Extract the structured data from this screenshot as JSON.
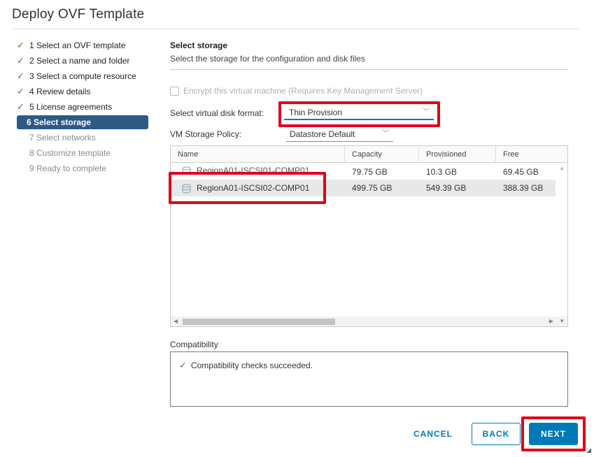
{
  "dialog": {
    "title": "Deploy OVF Template"
  },
  "steps": [
    {
      "label": "1 Select an OVF template",
      "state": "done"
    },
    {
      "label": "2 Select a name and folder",
      "state": "done"
    },
    {
      "label": "3 Select a compute resource",
      "state": "done"
    },
    {
      "label": "4 Review details",
      "state": "done"
    },
    {
      "label": "5 License agreements",
      "state": "done"
    },
    {
      "label": "6 Select storage",
      "state": "active"
    },
    {
      "label": "7 Select networks",
      "state": "pending"
    },
    {
      "label": "8 Customize template",
      "state": "pending"
    },
    {
      "label": "9 Ready to complete",
      "state": "pending"
    }
  ],
  "section": {
    "title": "Select storage",
    "subtitle": "Select the storage for the configuration and disk files"
  },
  "encrypt": {
    "label": "Encrypt this virtual machine (Requires Key Management Server)",
    "checked": false
  },
  "disk_format": {
    "label": "Select virtual disk format:",
    "value": "Thin Provision"
  },
  "storage_policy": {
    "label": "VM Storage Policy:",
    "value": "Datastore Default"
  },
  "table": {
    "columns": [
      "Name",
      "Capacity",
      "Provisioned",
      "Free"
    ],
    "rows": [
      {
        "name": "RegionA01-ISCSI01-COMP01",
        "capacity": "79.75 GB",
        "provisioned": "10.3 GB",
        "free": "69.45 GB",
        "selected": false
      },
      {
        "name": "RegionA01-ISCSI02-COMP01",
        "capacity": "499.75 GB",
        "provisioned": "549.39 GB",
        "free": "388.39 GB",
        "selected": true
      }
    ]
  },
  "compatibility": {
    "label": "Compatibility",
    "message": "Compatibility checks succeeded."
  },
  "buttons": {
    "cancel": "CANCEL",
    "back": "BACK",
    "next": "NEXT"
  },
  "colors": {
    "accent": "#0079b8",
    "active_step": "#2c5a86",
    "check": "#3c8d2e",
    "highlight": "#e0001a"
  }
}
